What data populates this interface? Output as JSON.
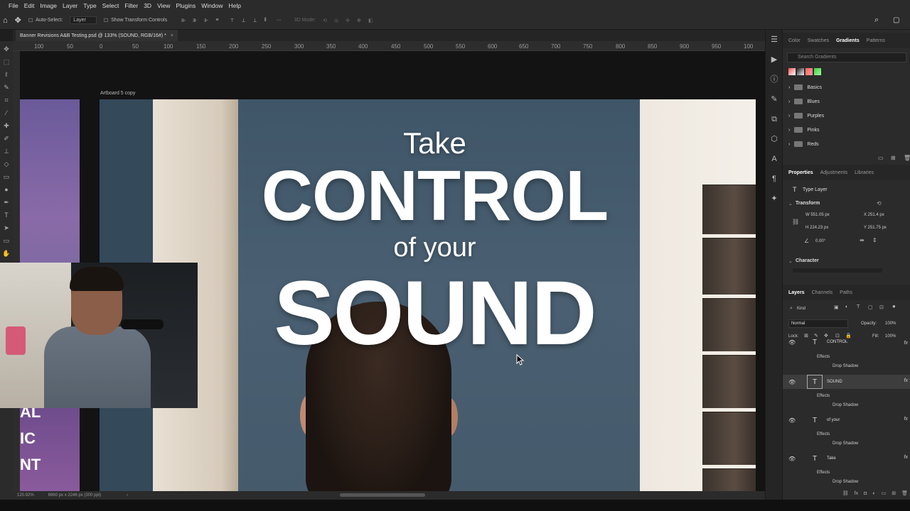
{
  "menu": [
    "File",
    "Edit",
    "Image",
    "Layer",
    "Type",
    "Select",
    "Filter",
    "3D",
    "View",
    "Plugins",
    "Window",
    "Help"
  ],
  "options": {
    "auto_select": "Auto-Select:",
    "layer_select": "Layer",
    "show_transform": "Show Transform Controls",
    "mode_3d": "3D Mode:",
    "more": "···"
  },
  "document": {
    "tab_title": "Banner Revisions A&B Testing.psd @ 133% (SOUND, RGB/16#) *",
    "artboard_label": "Artboard 5 copy",
    "zoom": "120.92%",
    "doc_size": "6960 px x 2246 px (300 ppi)"
  },
  "ruler": [
    "100",
    "50",
    "0",
    "50",
    "100",
    "150",
    "200",
    "250",
    "300",
    "350",
    "400",
    "450",
    "500",
    "550",
    "600",
    "650",
    "700",
    "750",
    "800",
    "850",
    "900",
    "950",
    "100"
  ],
  "artboard": {
    "line1": "Take",
    "line2": "CONTROL",
    "line3": "of your",
    "line4": "SOUND"
  },
  "left_strip_text": [
    "AL",
    "IC",
    "NT"
  ],
  "panels": {
    "top_tabs": [
      "Color",
      "Swatches",
      "Gradients",
      "Patterns"
    ],
    "active_top_tab": "Gradients",
    "search_placeholder": "Search Gradients",
    "gradient_folders": [
      "Basics",
      "Blues",
      "Purples",
      "Pinks",
      "Reds"
    ],
    "prop_tabs": [
      "Properties",
      "Adjustments",
      "Libraries"
    ],
    "active_prop_tab": "Properties",
    "type_layer": "Type Layer",
    "transform_label": "Transform",
    "w": "W  551.05 px",
    "x": "X  251.4 px",
    "h": "H  224.23 px",
    "y": "Y  251.75 px",
    "angle": "0.00°",
    "character_label": "Character",
    "layer_tabs": [
      "Layers",
      "Channels",
      "Paths"
    ],
    "active_layer_tab": "Layers",
    "kind": "Kind",
    "blend_mode": "Normal",
    "opacity_label": "Opacity:",
    "opacity": "100%",
    "lock_label": "Lock:",
    "fill_label": "Fill:",
    "fill": "100%"
  },
  "layers": [
    {
      "name": "CONTROL",
      "effects": "Effects",
      "shadow": "Drop Shadow",
      "selected": false
    },
    {
      "name": "SOUND",
      "effects": "Effects",
      "shadow": "Drop Shadow",
      "selected": true
    },
    {
      "name": "of your",
      "effects": "Effects",
      "shadow": "Drop Shadow",
      "selected": false
    },
    {
      "name": "Take",
      "effects": "Effects",
      "shadow": "Drop Shadow",
      "selected": false
    }
  ],
  "colors": {
    "ps_bg": "#1e1e1e",
    "panel_bg": "#2b2b2b",
    "artboard_blue": "#3f5668"
  }
}
